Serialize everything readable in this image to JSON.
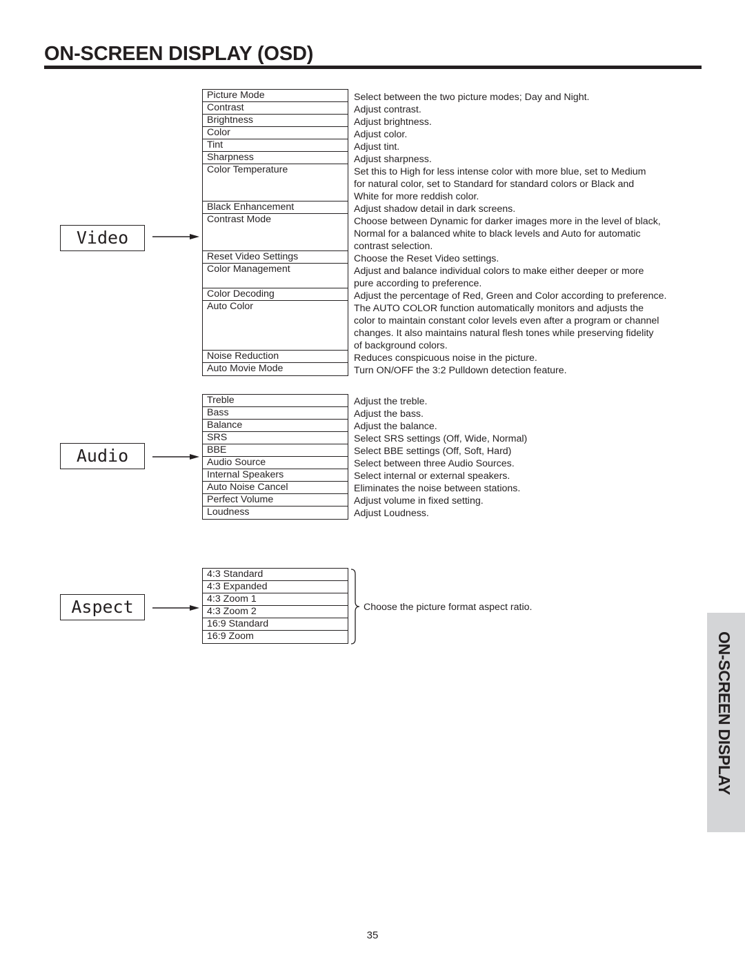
{
  "header": {
    "title": "ON-SCREEN DISPLAY (OSD)"
  },
  "sections": {
    "video": {
      "label": "Video",
      "items": [
        {
          "name": "Picture Mode",
          "desc": [
            "Select between the two picture modes; Day and Night."
          ]
        },
        {
          "name": "Contrast",
          "desc": [
            "Adjust contrast."
          ]
        },
        {
          "name": "Brightness",
          "desc": [
            "Adjust brightness."
          ]
        },
        {
          "name": "Color",
          "desc": [
            "Adjust color."
          ]
        },
        {
          "name": "Tint",
          "desc": [
            "Adjust tint."
          ]
        },
        {
          "name": "Sharpness",
          "desc": [
            "Adjust sharpness."
          ]
        },
        {
          "name": "Color Temperature",
          "desc": [
            "Set this to High for less intense color with more blue, set to Medium",
            "for natural color, set to Standard for standard colors or Black and",
            "White for more reddish color."
          ]
        },
        {
          "name": "Black Enhancement",
          "desc": [
            "Adjust shadow detail in dark screens."
          ]
        },
        {
          "name": "Contrast Mode",
          "desc": [
            "Choose between Dynamic for darker images more in the level of black,",
            "Normal for a balanced white to black levels and Auto for automatic",
            "contrast selection."
          ]
        },
        {
          "name": "Reset Video Settings",
          "desc": [
            "Choose the Reset Video settings."
          ]
        },
        {
          "name": "Color Management",
          "desc": [
            "Adjust and balance individual colors to make either deeper or more",
            "pure according to preference."
          ]
        },
        {
          "name": "Color Decoding",
          "desc": [
            "Adjust the percentage of Red, Green and Color according to preference."
          ]
        },
        {
          "name": "Auto Color",
          "desc": [
            "The AUTO COLOR function automatically monitors and adjusts the",
            "color to maintain constant color levels even after a program or channel",
            "changes. It also maintains natural flesh tones while preserving fidelity",
            "of background colors."
          ]
        },
        {
          "name": "Noise Reduction",
          "desc": [
            "Reduces conspicuous noise in the picture."
          ]
        },
        {
          "name": "Auto Movie Mode",
          "desc": [
            "Turn ON/OFF the 3:2 Pulldown detection feature."
          ]
        }
      ]
    },
    "audio": {
      "label": "Audio",
      "items": [
        {
          "name": "Treble",
          "desc": [
            "Adjust the treble."
          ]
        },
        {
          "name": "Bass",
          "desc": [
            "Adjust the bass."
          ]
        },
        {
          "name": "Balance",
          "desc": [
            "Adjust the balance."
          ]
        },
        {
          "name": "SRS",
          "desc": [
            "Select SRS settings (Off, Wide, Normal)"
          ]
        },
        {
          "name": "BBE",
          "desc": [
            "Select BBE settings (Off, Soft, Hard)"
          ]
        },
        {
          "name": "Audio Source",
          "desc": [
            "Select between three Audio Sources."
          ]
        },
        {
          "name": "Internal Speakers",
          "desc": [
            "Select internal or external speakers."
          ]
        },
        {
          "name": "Auto Noise Cancel",
          "desc": [
            "Eliminates the noise between stations."
          ]
        },
        {
          "name": "Perfect Volume",
          "desc": [
            "Adjust volume in fixed setting."
          ]
        },
        {
          "name": "Loudness",
          "desc": [
            "Adjust Loudness."
          ]
        }
      ]
    },
    "aspect": {
      "label": "Aspect",
      "items": [
        "4:3 Standard",
        "4:3 Expanded",
        "4:3 Zoom 1",
        "4:3 Zoom 2",
        "16:9 Standard",
        "16:9 Zoom"
      ],
      "desc": "Choose the picture format aspect ratio."
    }
  },
  "side_tab": {
    "label": "ON-SCREEN DISPLAY"
  },
  "footer": {
    "page_number": "35"
  }
}
